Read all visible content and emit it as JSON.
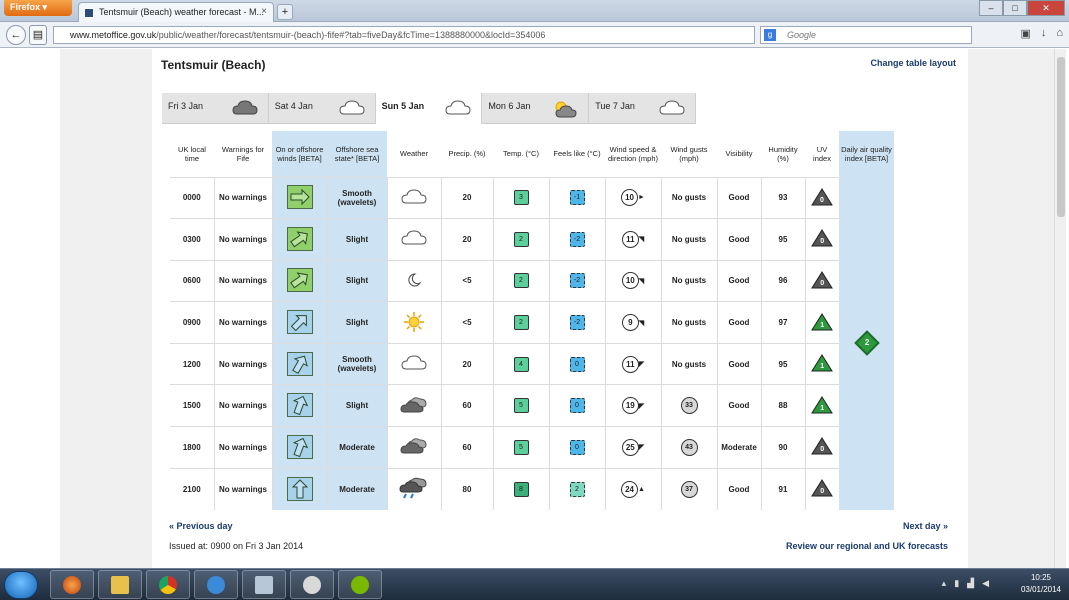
{
  "browser": {
    "menu_label": "Firefox",
    "tab_title": "Tentsmuir (Beach) weather forecast - M...",
    "new_tab": "+",
    "url_domain": "www.metoffice.gov.uk",
    "url_path": "/public/weather/forecast/tentsmuir-(beach)-fife#?tab=fiveDay&fcTime=1388880000&locId=354006",
    "search_placeholder": "Google"
  },
  "page": {
    "title": "Tentsmuir (Beach)",
    "change_layout": "Change table layout",
    "day_tabs": [
      {
        "label": "Fri 3 Jan",
        "icon": "cloud-dark-icon"
      },
      {
        "label": "Sat 4 Jan",
        "icon": "cloud-icon"
      },
      {
        "label": "Sun 5 Jan",
        "icon": "cloud-icon",
        "active": true
      },
      {
        "label": "Mon 6 Jan",
        "icon": "sun-cloud-icon"
      },
      {
        "label": "Tue 7 Jan",
        "icon": "cloud-icon"
      }
    ],
    "headers": {
      "time": "UK local time",
      "warnings": "Warnings for Fife",
      "winds": "On or offshore winds [BETA]",
      "sea": "Offshore sea state* [BETA]",
      "weather": "Weather",
      "precip": "Precip. (%)",
      "temp": "Temp. (°C)",
      "feels": "Feels like (°C)",
      "windspeed": "Wind speed & direction (mph)",
      "gusts": "Wind gusts (mph)",
      "visibility": "Visibility",
      "humidity": "Humidity (%)",
      "uv": "UV index",
      "airq": "Daily air quality index [BETA]"
    },
    "rows": [
      {
        "time": "0000",
        "warn": "No warnings",
        "sea": "Smooth (wavelets)",
        "wx": "cloud",
        "precip": "20",
        "temp": "3",
        "feels": "-1",
        "wind": "10",
        "gust": "No gusts",
        "vis": "Good",
        "hum": "93",
        "uv": "0"
      },
      {
        "time": "0300",
        "warn": "No warnings",
        "sea": "Slight",
        "wx": "cloud",
        "precip": "20",
        "temp": "2",
        "feels": "-2",
        "wind": "11",
        "gust": "No gusts",
        "vis": "Good",
        "hum": "95",
        "uv": "0"
      },
      {
        "time": "0600",
        "warn": "No warnings",
        "sea": "Slight",
        "wx": "moon",
        "precip": "<5",
        "temp": "2",
        "feels": "-2",
        "wind": "10",
        "gust": "No gusts",
        "vis": "Good",
        "hum": "96",
        "uv": "0"
      },
      {
        "time": "0900",
        "warn": "No warnings",
        "sea": "Slight",
        "wx": "sun",
        "precip": "<5",
        "temp": "2",
        "feels": "-2",
        "wind": "9",
        "gust": "No gusts",
        "vis": "Good",
        "hum": "97",
        "uv": "1"
      },
      {
        "time": "1200",
        "warn": "No warnings",
        "sea": "Smooth (wavelets)",
        "wx": "cloud",
        "precip": "20",
        "temp": "4",
        "feels": "0",
        "wind": "11",
        "gust": "No gusts",
        "vis": "Good",
        "hum": "95",
        "uv": "1"
      },
      {
        "time": "1500",
        "warn": "No warnings",
        "sea": "Slight",
        "wx": "dark-cloud",
        "precip": "60",
        "temp": "5",
        "feels": "0",
        "wind": "19",
        "gust": "33",
        "vis": "Good",
        "hum": "88",
        "uv": "1"
      },
      {
        "time": "1800",
        "warn": "No warnings",
        "sea": "Moderate",
        "wx": "dark-cloud",
        "precip": "60",
        "temp": "5",
        "feels": "0",
        "wind": "25",
        "gust": "43",
        "vis": "Moderate",
        "hum": "90",
        "uv": "0"
      },
      {
        "time": "2100",
        "warn": "No warnings",
        "sea": "Moderate",
        "wx": "rain-cloud",
        "precip": "80",
        "temp": "8",
        "feels": "2",
        "wind": "24",
        "gust": "37",
        "vis": "Good",
        "hum": "91",
        "uv": "0"
      }
    ],
    "air_quality": "2",
    "prev_day": "« Previous day",
    "next_day": "Next day »",
    "issued": "Issued at: 0900 on Fri 3 Jan 2014",
    "review": "Review our regional and UK forecasts"
  },
  "taskbar": {
    "time": "10:25",
    "date": "03/01/2014"
  },
  "colors": {
    "temp_green": "#5ccf9a",
    "feels_blue": "#4fb6ea",
    "uv_green": "#2c9a3c",
    "uv_grey": "#555555"
  }
}
